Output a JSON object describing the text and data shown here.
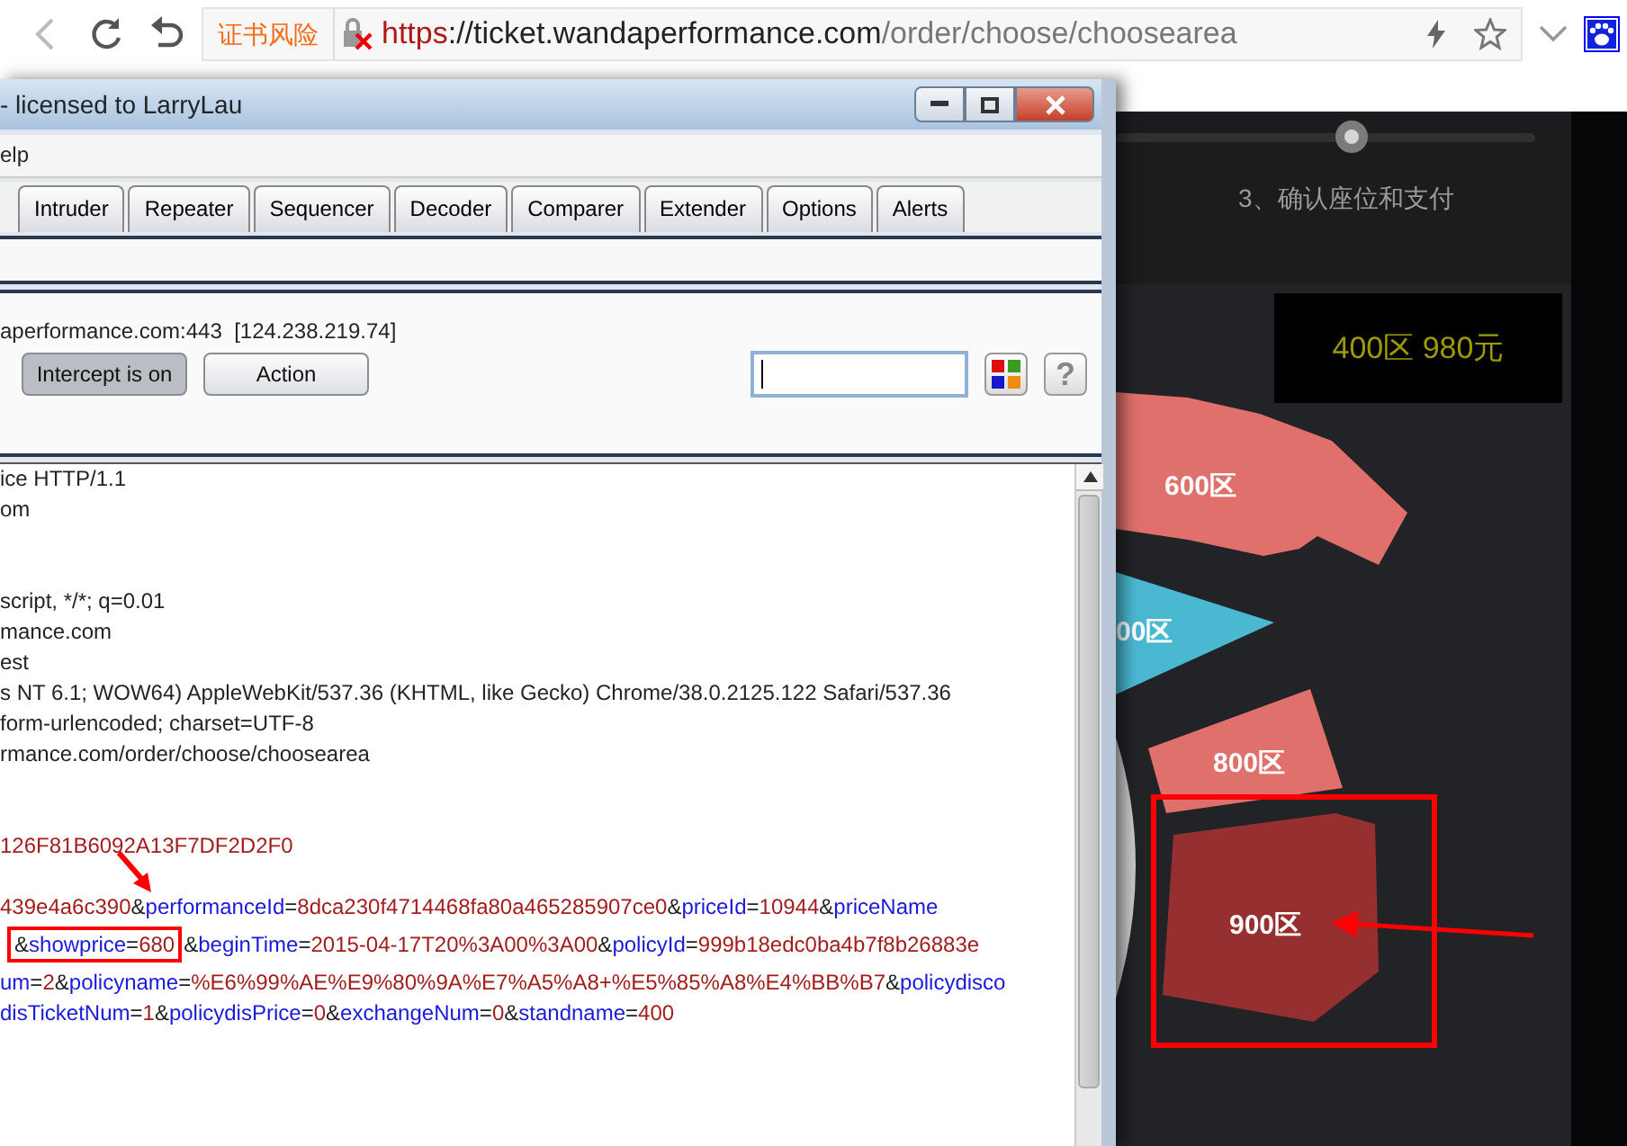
{
  "browser": {
    "cert_warning": "证书风险",
    "url": {
      "scheme": "https",
      "host": "://ticket.wandaperformance.com",
      "path": "/order/choose/choosearea"
    }
  },
  "burp": {
    "title": "- licensed to LarryLau",
    "menu": [
      "elp"
    ],
    "tabs": [
      {
        "label": "Intruder",
        "selected": false
      },
      {
        "label": "Repeater",
        "selected": false
      },
      {
        "label": "Sequencer",
        "selected": false
      },
      {
        "label": "Decoder",
        "selected": false
      },
      {
        "label": "Comparer",
        "selected": false
      },
      {
        "label": "Extender",
        "selected": false
      },
      {
        "label": "Options",
        "selected": false
      },
      {
        "label": "Alerts",
        "selected": false
      }
    ],
    "host": "aperformance.com:443  [124.238.219.74]",
    "buttons": [
      {
        "label": "Intercept is on",
        "pressed": true
      },
      {
        "label": "Action",
        "pressed": false
      }
    ],
    "help": "?",
    "request": [
      {
        "kind": "plain",
        "text": "ice HTTP/1.1"
      },
      {
        "kind": "plain",
        "text": "om"
      },
      {
        "kind": "blank"
      },
      {
        "kind": "blank"
      },
      {
        "kind": "plain",
        "text": "script, */*; q=0.01"
      },
      {
        "kind": "plain",
        "text": "mance.com"
      },
      {
        "kind": "plain",
        "text": "est"
      },
      {
        "kind": "plain",
        "text": "s NT 6.1; WOW64) AppleWebKit/537.36 (KHTML, like Gecko) Chrome/38.0.2125.122 Safari/537.36"
      },
      {
        "kind": "plain",
        "text": "form-urlencoded; charset=UTF-8"
      },
      {
        "kind": "plain",
        "text": "rmance.com/order/choose/choosearea"
      },
      {
        "kind": "blank"
      },
      {
        "kind": "blank"
      },
      {
        "kind": "params",
        "tokens": [
          {
            "kind": "value",
            "text": "126F81B6092A13F7DF2D2F0"
          }
        ]
      },
      {
        "kind": "blank"
      },
      {
        "kind": "params",
        "tokens": [
          {
            "kind": "value",
            "text": "439e4a6c390"
          },
          {
            "kind": "sep",
            "text": "&"
          },
          {
            "kind": "key",
            "text": "performanceId"
          },
          {
            "kind": "sep",
            "text": "="
          },
          {
            "kind": "value",
            "text": "8dca230f4714468fa80a465285907ce0"
          },
          {
            "kind": "sep",
            "text": "&"
          },
          {
            "kind": "key",
            "text": "priceId"
          },
          {
            "kind": "sep",
            "text": "="
          },
          {
            "kind": "value",
            "text": "10944"
          },
          {
            "kind": "sep",
            "text": "&"
          },
          {
            "kind": "key",
            "text": "priceName"
          }
        ]
      },
      {
        "kind": "params",
        "tokens": [
          {
            "kind": "sep",
            "text": "&",
            "boxed": true
          },
          {
            "kind": "key",
            "text": "showprice",
            "boxed": true
          },
          {
            "kind": "sep",
            "text": "=",
            "boxed": true
          },
          {
            "kind": "value",
            "text": "680",
            "boxed": true
          },
          {
            "kind": "sep",
            "text": "&",
            "boxed": false
          },
          {
            "kind": "key",
            "text": "beginTime",
            "boxed": false
          },
          {
            "kind": "sep",
            "text": "=",
            "boxed": false
          },
          {
            "kind": "value",
            "text": "2015-04-17T20%3A00%3A00",
            "boxed": false
          },
          {
            "kind": "sep",
            "text": "&",
            "boxed": false
          },
          {
            "kind": "key",
            "text": "policyId",
            "boxed": false
          },
          {
            "kind": "sep",
            "text": "=",
            "boxed": false
          },
          {
            "kind": "value",
            "text": "999b18edc0ba4b7f8b26883e",
            "boxed": false
          }
        ]
      },
      {
        "kind": "params",
        "tokens": [
          {
            "kind": "key",
            "text": "um"
          },
          {
            "kind": "sep",
            "text": "="
          },
          {
            "kind": "value",
            "text": "2"
          },
          {
            "kind": "sep",
            "text": "&"
          },
          {
            "kind": "key",
            "text": "policyname"
          },
          {
            "kind": "sep",
            "text": "="
          },
          {
            "kind": "value",
            "text": "%E6%99%AE%E9%80%9A%E7%A5%A8+%E5%85%A8%E4%BB%B7"
          },
          {
            "kind": "sep",
            "text": "&"
          },
          {
            "kind": "key",
            "text": "policydisco"
          }
        ]
      },
      {
        "kind": "params",
        "tokens": [
          {
            "kind": "key",
            "text": "disTicketNum"
          },
          {
            "kind": "sep",
            "text": "="
          },
          {
            "kind": "value",
            "text": "1"
          },
          {
            "kind": "sep",
            "text": "&"
          },
          {
            "kind": "key",
            "text": "policydisPrice"
          },
          {
            "kind": "sep",
            "text": "="
          },
          {
            "kind": "value",
            "text": "0"
          },
          {
            "kind": "sep",
            "text": "&"
          },
          {
            "kind": "key",
            "text": "exchangeNum"
          },
          {
            "kind": "sep",
            "text": "="
          },
          {
            "kind": "value",
            "text": "0"
          },
          {
            "kind": "sep",
            "text": "&"
          },
          {
            "kind": "key",
            "text": "standname"
          },
          {
            "kind": "sep",
            "text": "="
          },
          {
            "kind": "value",
            "text": "400"
          }
        ]
      }
    ]
  },
  "page": {
    "step_label": "3、确认座位和支付",
    "price_tip": "400区 980元",
    "sections": [
      {
        "label": "600区",
        "color": "#e0706b"
      },
      {
        "label": "00区",
        "color": "#4bb8d2"
      },
      {
        "label": "800区",
        "color": "#e0706b"
      },
      {
        "label": "900区",
        "color": "#962f2f"
      }
    ]
  }
}
